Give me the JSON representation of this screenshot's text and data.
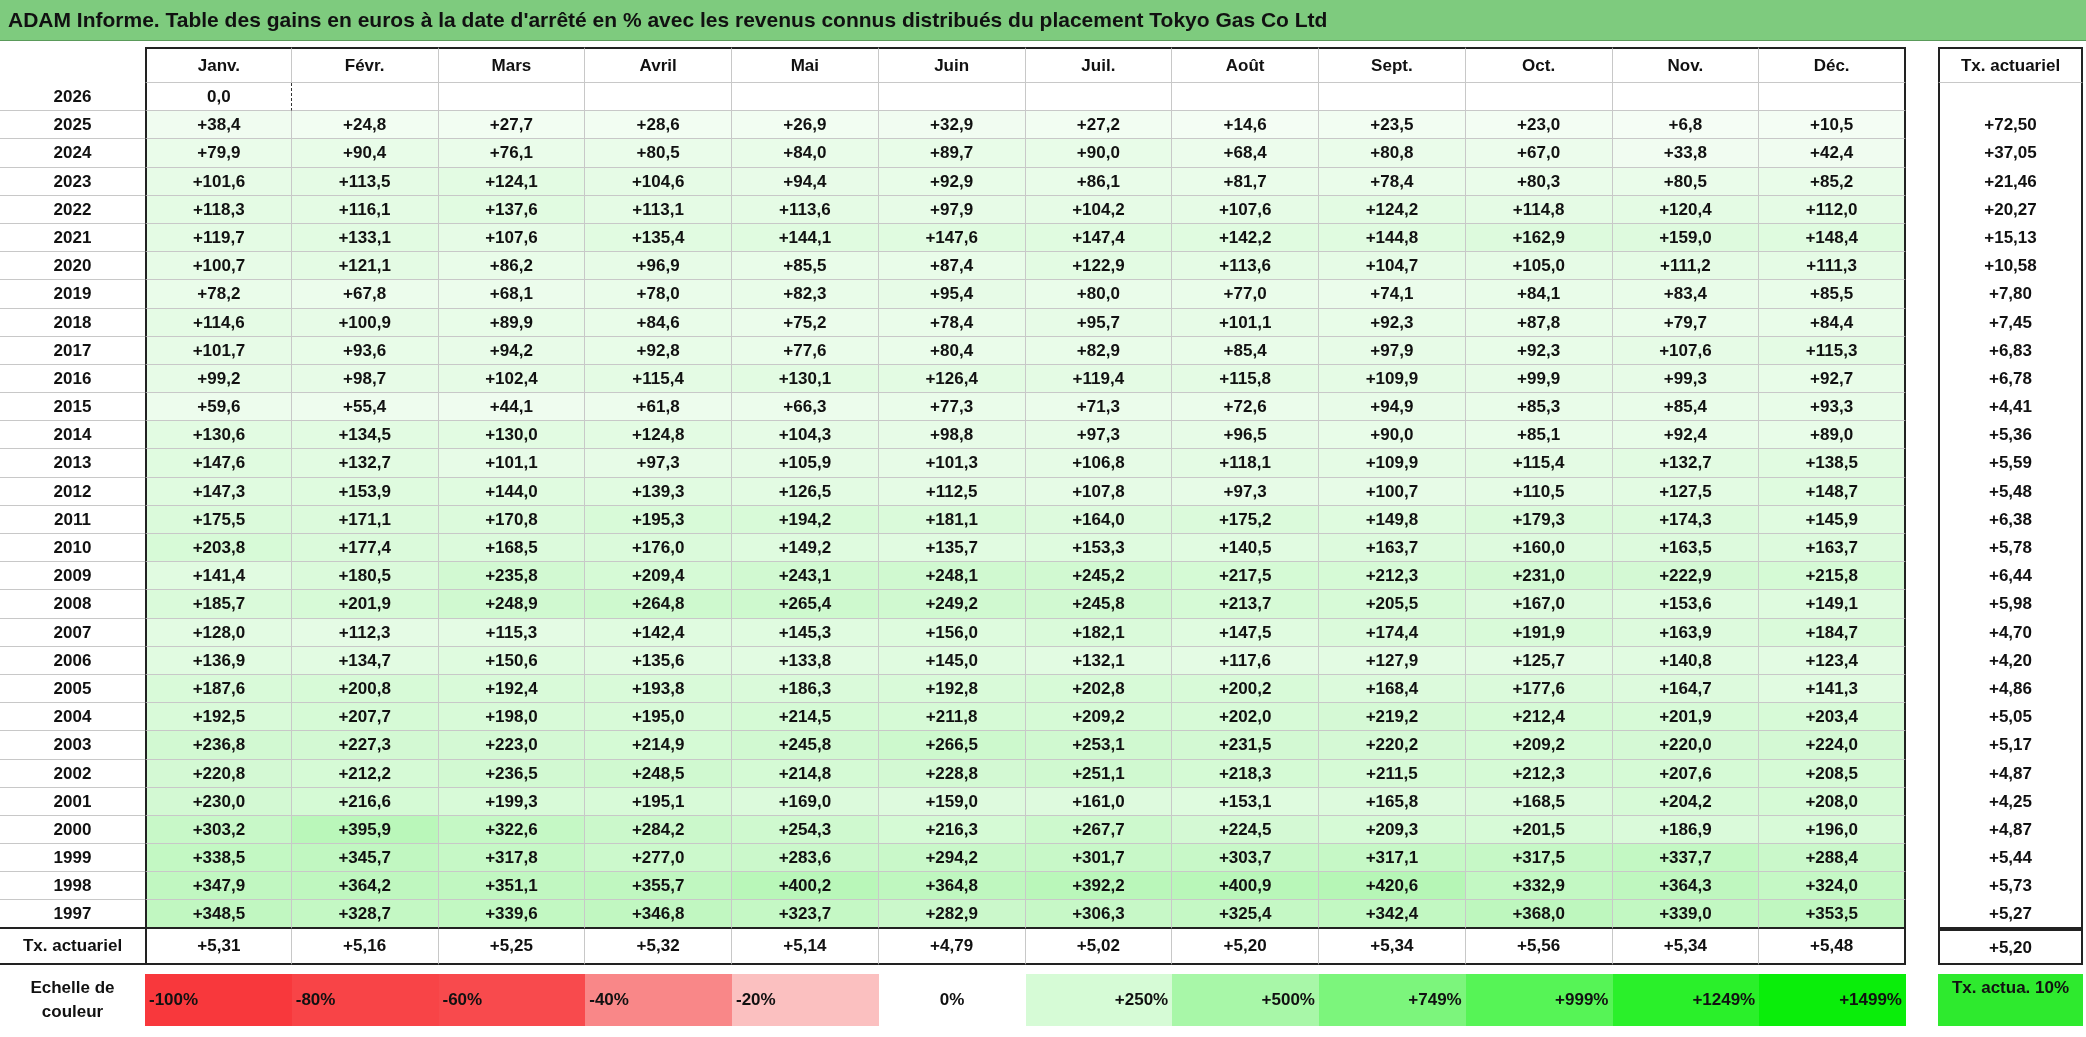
{
  "title": "ADAM Informe. Table des gains en euros à la date d'arrêté en % avec les revenus connus distribués du placement Tokyo Gas Co Ltd",
  "table": {
    "columns": [
      "Janv.",
      "Févr.",
      "Mars",
      "Avril",
      "Mai",
      "Juin",
      "Juil.",
      "Août",
      "Sept.",
      "Oct.",
      "Nov.",
      "Déc."
    ],
    "rate_column": "Tx. actuariel",
    "rows": [
      {
        "year": "2026",
        "values": [
          "0,0"
        ]
      },
      {
        "year": "2025",
        "values": [
          "+38,4",
          "+24,8",
          "+27,7",
          "+28,6",
          "+26,9",
          "+32,9",
          "+27,2",
          "+14,6",
          "+23,5",
          "+23,0",
          "+6,8",
          "+10,5"
        ],
        "rate": "+72,50"
      },
      {
        "year": "2024",
        "values": [
          "+79,9",
          "+90,4",
          "+76,1",
          "+80,5",
          "+84,0",
          "+89,7",
          "+90,0",
          "+68,4",
          "+80,8",
          "+67,0",
          "+33,8",
          "+42,4"
        ],
        "rate": "+37,05"
      },
      {
        "year": "2023",
        "values": [
          "+101,6",
          "+113,5",
          "+124,1",
          "+104,6",
          "+94,4",
          "+92,9",
          "+86,1",
          "+81,7",
          "+78,4",
          "+80,3",
          "+80,5",
          "+85,2"
        ],
        "rate": "+21,46"
      },
      {
        "year": "2022",
        "values": [
          "+118,3",
          "+116,1",
          "+137,6",
          "+113,1",
          "+113,6",
          "+97,9",
          "+104,2",
          "+107,6",
          "+124,2",
          "+114,8",
          "+120,4",
          "+112,0"
        ],
        "rate": "+20,27"
      },
      {
        "year": "2021",
        "values": [
          "+119,7",
          "+133,1",
          "+107,6",
          "+135,4",
          "+144,1",
          "+147,6",
          "+147,4",
          "+142,2",
          "+144,8",
          "+162,9",
          "+159,0",
          "+148,4"
        ],
        "rate": "+15,13"
      },
      {
        "year": "2020",
        "values": [
          "+100,7",
          "+121,1",
          "+86,2",
          "+96,9",
          "+85,5",
          "+87,4",
          "+122,9",
          "+113,6",
          "+104,7",
          "+105,0",
          "+111,2",
          "+111,3"
        ],
        "rate": "+10,58"
      },
      {
        "year": "2019",
        "values": [
          "+78,2",
          "+67,8",
          "+68,1",
          "+78,0",
          "+82,3",
          "+95,4",
          "+80,0",
          "+77,0",
          "+74,1",
          "+84,1",
          "+83,4",
          "+85,5"
        ],
        "rate": "+7,80"
      },
      {
        "year": "2018",
        "values": [
          "+114,6",
          "+100,9",
          "+89,9",
          "+84,6",
          "+75,2",
          "+78,4",
          "+95,7",
          "+101,1",
          "+92,3",
          "+87,8",
          "+79,7",
          "+84,4"
        ],
        "rate": "+7,45"
      },
      {
        "year": "2017",
        "values": [
          "+101,7",
          "+93,6",
          "+94,2",
          "+92,8",
          "+77,6",
          "+80,4",
          "+82,9",
          "+85,4",
          "+97,9",
          "+92,3",
          "+107,6",
          "+115,3"
        ],
        "rate": "+6,83"
      },
      {
        "year": "2016",
        "values": [
          "+99,2",
          "+98,7",
          "+102,4",
          "+115,4",
          "+130,1",
          "+126,4",
          "+119,4",
          "+115,8",
          "+109,9",
          "+99,9",
          "+99,3",
          "+92,7"
        ],
        "rate": "+6,78"
      },
      {
        "year": "2015",
        "values": [
          "+59,6",
          "+55,4",
          "+44,1",
          "+61,8",
          "+66,3",
          "+77,3",
          "+71,3",
          "+72,6",
          "+94,9",
          "+85,3",
          "+85,4",
          "+93,3"
        ],
        "rate": "+4,41"
      },
      {
        "year": "2014",
        "values": [
          "+130,6",
          "+134,5",
          "+130,0",
          "+124,8",
          "+104,3",
          "+98,8",
          "+97,3",
          "+96,5",
          "+90,0",
          "+85,1",
          "+92,4",
          "+89,0"
        ],
        "rate": "+5,36"
      },
      {
        "year": "2013",
        "values": [
          "+147,6",
          "+132,7",
          "+101,1",
          "+97,3",
          "+105,9",
          "+101,3",
          "+106,8",
          "+118,1",
          "+109,9",
          "+115,4",
          "+132,7",
          "+138,5"
        ],
        "rate": "+5,59"
      },
      {
        "year": "2012",
        "values": [
          "+147,3",
          "+153,9",
          "+144,0",
          "+139,3",
          "+126,5",
          "+112,5",
          "+107,8",
          "+97,3",
          "+100,7",
          "+110,5",
          "+127,5",
          "+148,7"
        ],
        "rate": "+5,48"
      },
      {
        "year": "2011",
        "values": [
          "+175,5",
          "+171,1",
          "+170,8",
          "+195,3",
          "+194,2",
          "+181,1",
          "+164,0",
          "+175,2",
          "+149,8",
          "+179,3",
          "+174,3",
          "+145,9"
        ],
        "rate": "+6,38"
      },
      {
        "year": "2010",
        "values": [
          "+203,8",
          "+177,4",
          "+168,5",
          "+176,0",
          "+149,2",
          "+135,7",
          "+153,3",
          "+140,5",
          "+163,7",
          "+160,0",
          "+163,5",
          "+163,7"
        ],
        "rate": "+5,78"
      },
      {
        "year": "2009",
        "values": [
          "+141,4",
          "+180,5",
          "+235,8",
          "+209,4",
          "+243,1",
          "+248,1",
          "+245,2",
          "+217,5",
          "+212,3",
          "+231,0",
          "+222,9",
          "+215,8"
        ],
        "rate": "+6,44"
      },
      {
        "year": "2008",
        "values": [
          "+185,7",
          "+201,9",
          "+248,9",
          "+264,8",
          "+265,4",
          "+249,2",
          "+245,8",
          "+213,7",
          "+205,5",
          "+167,0",
          "+153,6",
          "+149,1"
        ],
        "rate": "+5,98"
      },
      {
        "year": "2007",
        "values": [
          "+128,0",
          "+112,3",
          "+115,3",
          "+142,4",
          "+145,3",
          "+156,0",
          "+182,1",
          "+147,5",
          "+174,4",
          "+191,9",
          "+163,9",
          "+184,7"
        ],
        "rate": "+4,70"
      },
      {
        "year": "2006",
        "values": [
          "+136,9",
          "+134,7",
          "+150,6",
          "+135,6",
          "+133,8",
          "+145,0",
          "+132,1",
          "+117,6",
          "+127,9",
          "+125,7",
          "+140,8",
          "+123,4"
        ],
        "rate": "+4,20"
      },
      {
        "year": "2005",
        "values": [
          "+187,6",
          "+200,8",
          "+192,4",
          "+193,8",
          "+186,3",
          "+192,8",
          "+202,8",
          "+200,2",
          "+168,4",
          "+177,6",
          "+164,7",
          "+141,3"
        ],
        "rate": "+4,86"
      },
      {
        "year": "2004",
        "values": [
          "+192,5",
          "+207,7",
          "+198,0",
          "+195,0",
          "+214,5",
          "+211,8",
          "+209,2",
          "+202,0",
          "+219,2",
          "+212,4",
          "+201,9",
          "+203,4"
        ],
        "rate": "+5,05"
      },
      {
        "year": "2003",
        "values": [
          "+236,8",
          "+227,3",
          "+223,0",
          "+214,9",
          "+245,8",
          "+266,5",
          "+253,1",
          "+231,5",
          "+220,2",
          "+209,2",
          "+220,0",
          "+224,0"
        ],
        "rate": "+5,17"
      },
      {
        "year": "2002",
        "values": [
          "+220,8",
          "+212,2",
          "+236,5",
          "+248,5",
          "+214,8",
          "+228,8",
          "+251,1",
          "+218,3",
          "+211,5",
          "+212,3",
          "+207,6",
          "+208,5"
        ],
        "rate": "+4,87"
      },
      {
        "year": "2001",
        "values": [
          "+230,0",
          "+216,6",
          "+199,3",
          "+195,1",
          "+169,0",
          "+159,0",
          "+161,0",
          "+153,1",
          "+165,8",
          "+168,5",
          "+204,2",
          "+208,0"
        ],
        "rate": "+4,25"
      },
      {
        "year": "2000",
        "values": [
          "+303,2",
          "+395,9",
          "+322,6",
          "+284,2",
          "+254,3",
          "+216,3",
          "+267,7",
          "+224,5",
          "+209,3",
          "+201,5",
          "+186,9",
          "+196,0"
        ],
        "rate": "+4,87"
      },
      {
        "year": "1999",
        "values": [
          "+338,5",
          "+345,7",
          "+317,8",
          "+277,0",
          "+283,6",
          "+294,2",
          "+301,7",
          "+303,7",
          "+317,1",
          "+317,5",
          "+337,7",
          "+288,4"
        ],
        "rate": "+5,44"
      },
      {
        "year": "1998",
        "values": [
          "+347,9",
          "+364,2",
          "+351,1",
          "+355,7",
          "+400,2",
          "+364,8",
          "+392,2",
          "+400,9",
          "+420,6",
          "+332,9",
          "+364,3",
          "+324,0"
        ],
        "rate": "+5,73"
      },
      {
        "year": "1997",
        "values": [
          "+348,5",
          "+328,7",
          "+339,6",
          "+346,8",
          "+323,7",
          "+282,9",
          "+306,3",
          "+325,4",
          "+342,4",
          "+368,0",
          "+339,0",
          "+353,5"
        ],
        "rate": "+5,27"
      }
    ],
    "summary_row": {
      "label": "Tx. actuariel",
      "values": [
        "+5,31",
        "+5,16",
        "+5,25",
        "+5,32",
        "+5,14",
        "+4,79",
        "+5,02",
        "+5,20",
        "+5,34",
        "+5,56",
        "+5,34",
        "+5,48"
      ],
      "rate": "+5,20"
    }
  },
  "legend": {
    "label": "Echelle de couleur",
    "steps": [
      {
        "label": "-100%",
        "color": "#f8383c",
        "kind": "negative"
      },
      {
        "label": "-80%",
        "color": "#f84447",
        "kind": "negative"
      },
      {
        "label": "-60%",
        "color": "#f84a4d",
        "kind": "negative"
      },
      {
        "label": "-40%",
        "color": "#f98788",
        "kind": "negative"
      },
      {
        "label": "-20%",
        "color": "#fbc0c0",
        "kind": "negative"
      },
      {
        "label": "0%",
        "color": "#ffffff",
        "kind": "zero"
      },
      {
        "label": "+250%",
        "color": "#d6fbd6",
        "kind": "positive"
      },
      {
        "label": "+500%",
        "color": "#a8f7a8",
        "kind": "positive"
      },
      {
        "label": "+749%",
        "color": "#7cf57c",
        "kind": "positive"
      },
      {
        "label": "+999%",
        "color": "#56f456",
        "kind": "positive"
      },
      {
        "label": "+1249%",
        "color": "#2af02a",
        "kind": "positive"
      },
      {
        "label": "+1499%",
        "color": "#0aee0a",
        "kind": "positive"
      }
    ],
    "rate_step": {
      "label": "Tx. actua. 10%",
      "color": "#2eea2e"
    }
  }
}
